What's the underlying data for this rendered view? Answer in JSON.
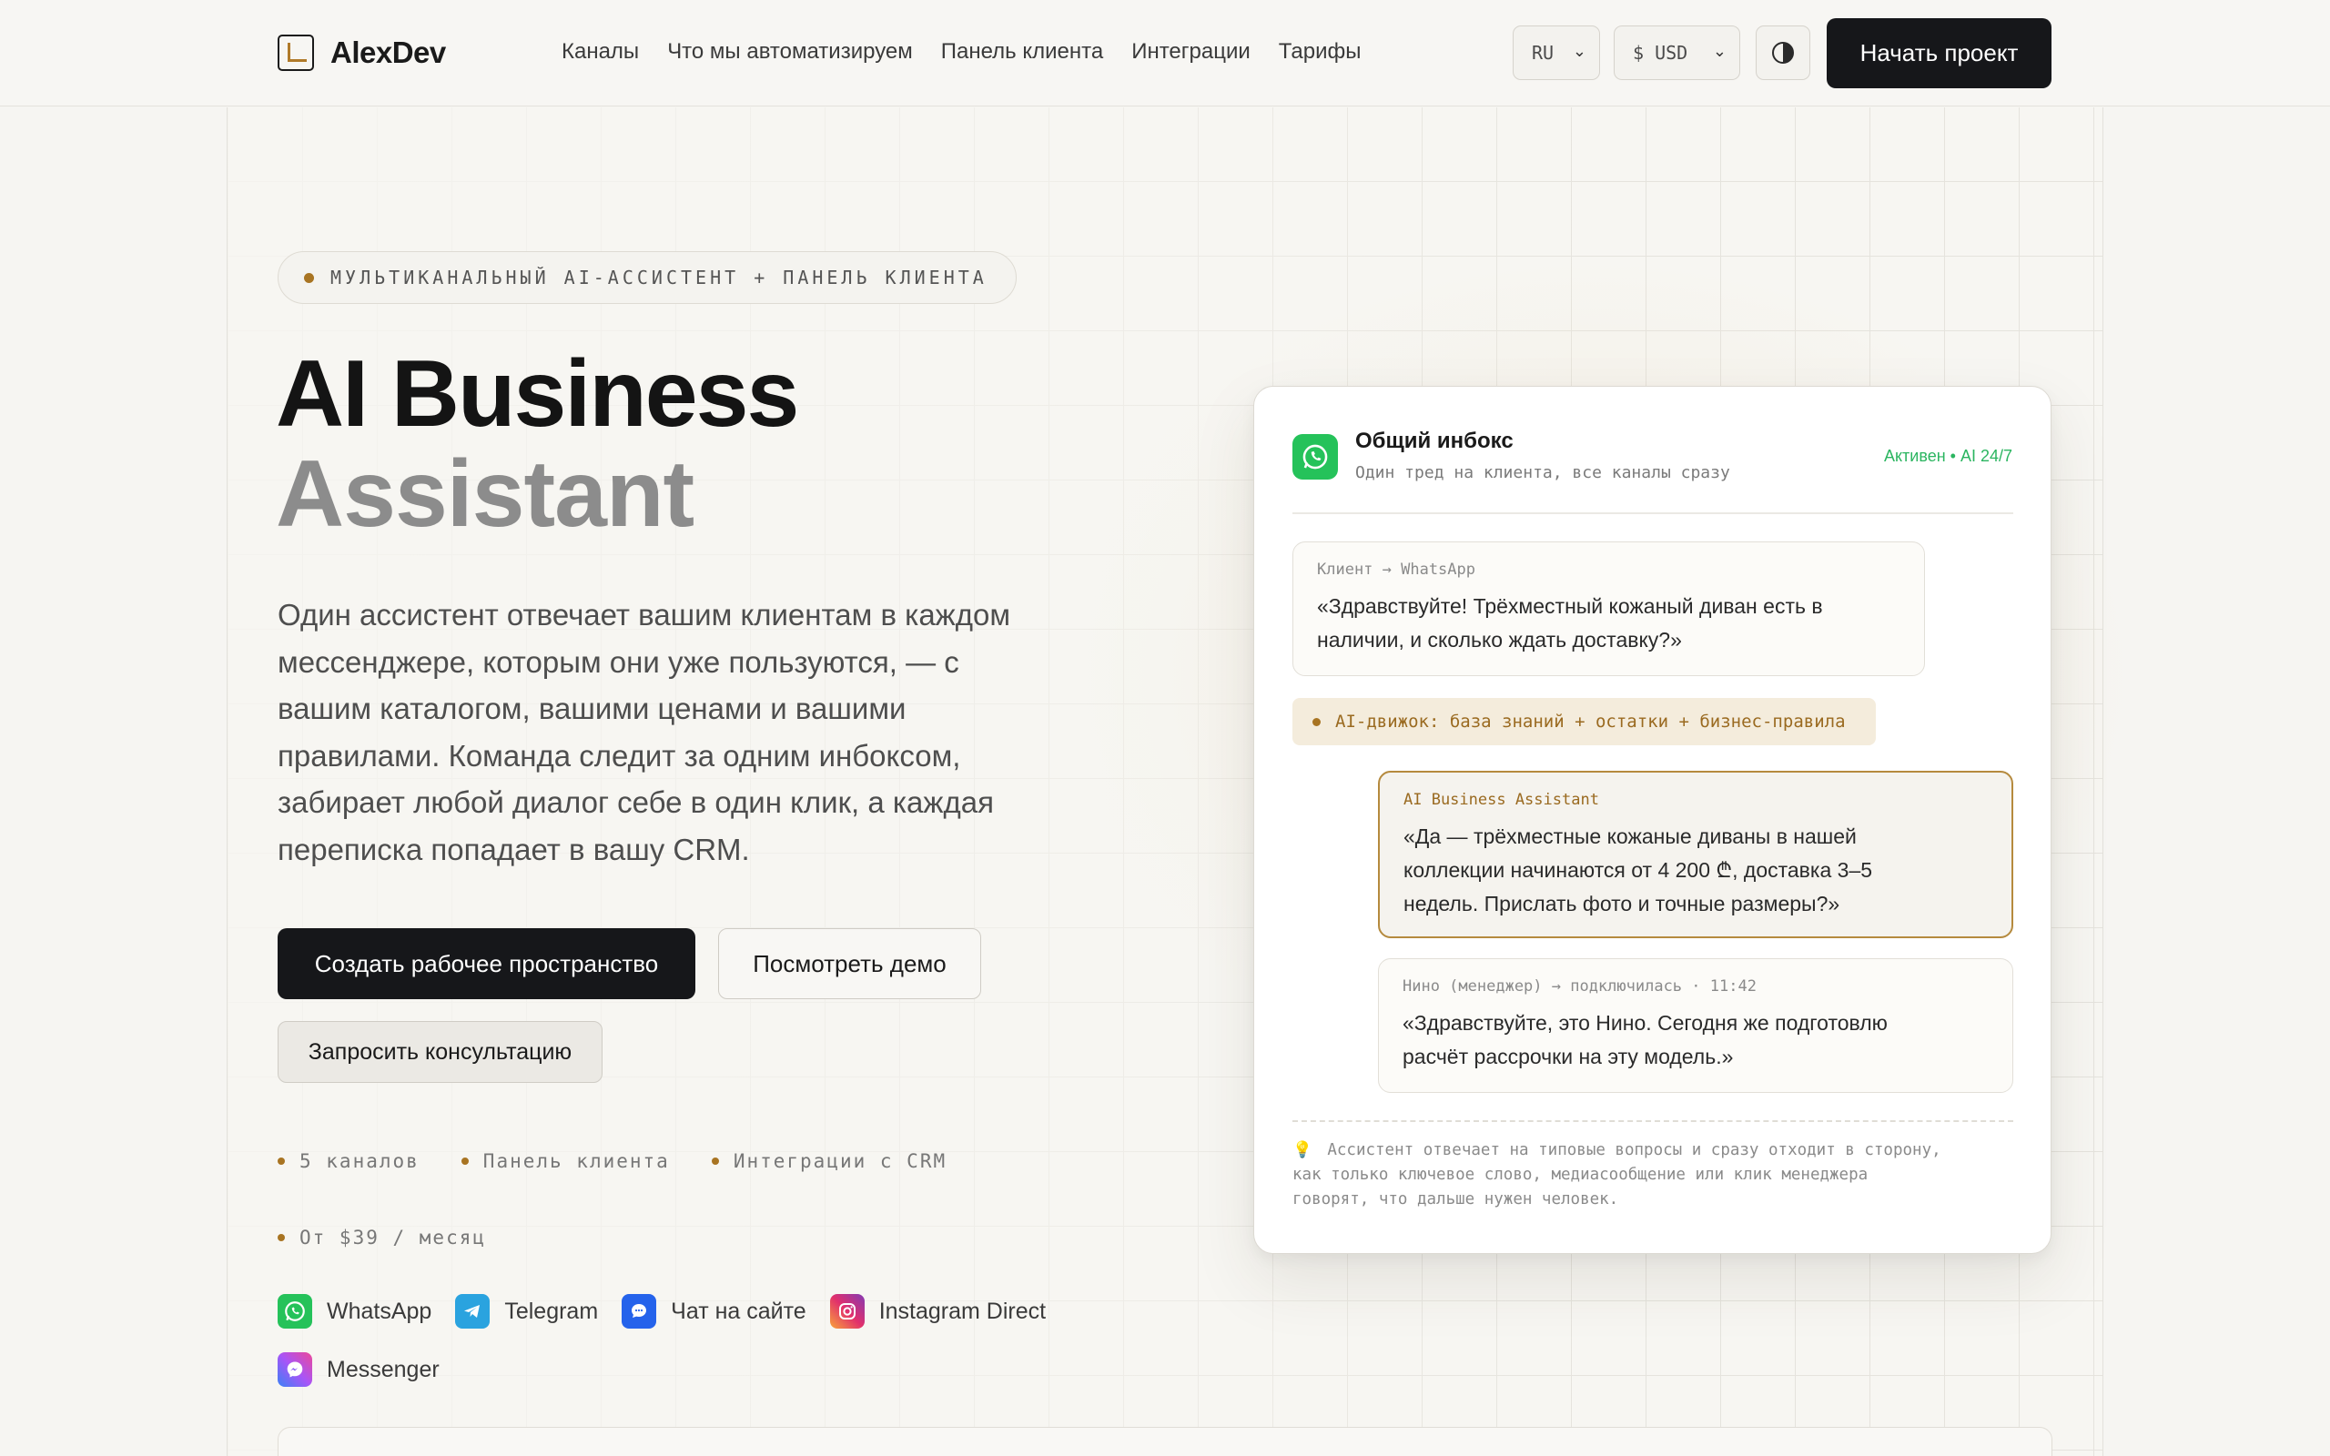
{
  "header": {
    "logo": "AlexDev",
    "nav": [
      "Каналы",
      "Что мы автоматизируем",
      "Панель клиента",
      "Интеграции",
      "Тарифы"
    ],
    "lang": "RU",
    "currency": "$ USD",
    "theme_icon": "contrast-icon",
    "cta": "Начать проект"
  },
  "hero": {
    "badge": "МУЛЬТИКАНАЛЬНЫЙ AI-АССИСТЕНТ + ПАНЕЛЬ КЛИЕНТА",
    "title_line1": "AI Business",
    "title_line2": "Assistant",
    "lead": "Один ассистент отвечает вашим клиентам в каждом мессенджере, которым они уже пользуются, — с вашим каталогом, вашими ценами и вашими правилами. Команда следит за одним инбоксом, забирает любой диалог себе в один клик, а каждая переписка попадает в вашу CRM.",
    "btn_primary": "Создать рабочее пространство",
    "btn_demo": "Посмотреть демо",
    "btn_consult": "Запросить консультацию",
    "facts": [
      "5 каналов",
      "Панель клиента",
      "Интеграции с CRM"
    ],
    "price": "От $39 / месяц",
    "channels": [
      {
        "label": "WhatsApp",
        "icon": "whatsapp-icon",
        "color": "#25c25a"
      },
      {
        "label": "Telegram",
        "icon": "telegram-icon",
        "color": "#2aa3df"
      },
      {
        "label": "Чат на сайте",
        "icon": "chat-icon",
        "color": "#2563eb"
      },
      {
        "label": "Instagram Direct",
        "icon": "instagram-icon",
        "color": "#d62f7a"
      },
      {
        "label": "Messenger",
        "icon": "messenger-icon",
        "color": "#8b5cf6"
      }
    ]
  },
  "inbox": {
    "title": "Общий инбокс",
    "subtitle": "Один тред на клиента, все каналы сразу",
    "status": "Активен • AI 24/7",
    "msg1_label": "Клиент → WhatsApp",
    "msg1_line1": "«Здравствуйте! Трёхместный кожаный диван есть в",
    "msg1_line2": "наличии, и сколько ждать доставку?»",
    "engine": "AI-движок: база знаний + остатки + бизнес-правила",
    "msg2_label": "AI Business Assistant",
    "msg2_line1": "«Да — трёхместные кожаные диваны в нашей",
    "msg2_line2": "коллекции начинаются от 4 200 ₾, доставка 3–5",
    "msg2_line3": "недель. Прислать фото и точные размеры?»",
    "msg3_label": "Нино (менеджер) → подключилась · 11:42",
    "msg3_line1": "«Здравствуйте, это Нино. Сегодня же подготовлю",
    "msg3_line2": "расчёт рассрочки на эту модель.»",
    "note_line1": "Ассистент отвечает на типовые вопросы и сразу отходит в сторону,",
    "note_line2": "как только ключевое слово, медиасообщение или клик менеджера",
    "note_line3": "говорят, что дальше нужен человек."
  },
  "colors": {
    "accent": "#a87422",
    "dark": "#16171a",
    "green": "#25c25a"
  }
}
